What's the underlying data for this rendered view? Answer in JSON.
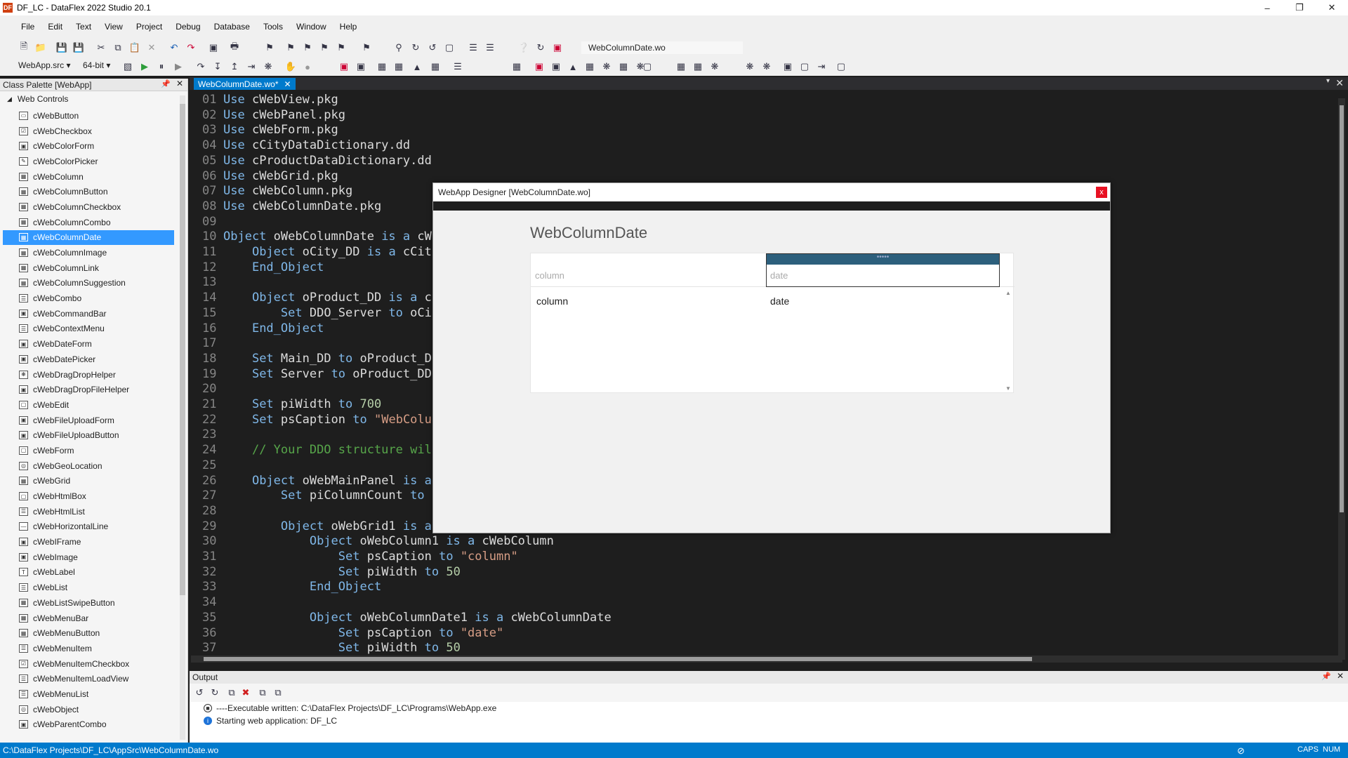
{
  "window": {
    "title": "DF_LC - DataFlex 2022 Studio 20.1",
    "logo": "DF"
  },
  "menu": [
    "File",
    "Edit",
    "Text",
    "View",
    "Project",
    "Debug",
    "Database",
    "Tools",
    "Window",
    "Help"
  ],
  "toolbar": {
    "current_file": "WebColumnDate.wo",
    "workspace": "WebApp.src",
    "bitness": "64-bit"
  },
  "class_palette": {
    "title": "Class Palette [WebApp]",
    "group": "Web Controls",
    "selected": "cWebColumnDate",
    "items": [
      "cWebButton",
      "cWebCheckbox",
      "cWebColorForm",
      "cWebColorPicker",
      "cWebColumn",
      "cWebColumnButton",
      "cWebColumnCheckbox",
      "cWebColumnCombo",
      "cWebColumnDate",
      "cWebColumnImage",
      "cWebColumnLink",
      "cWebColumnSuggestion",
      "cWebCombo",
      "cWebCommandBar",
      "cWebContextMenu",
      "cWebDateForm",
      "cWebDatePicker",
      "cWebDragDropHelper",
      "cWebDragDropFileHelper",
      "cWebEdit",
      "cWebFileUploadForm",
      "cWebFileUploadButton",
      "cWebForm",
      "cWebGeoLocation",
      "cWebGrid",
      "cWebHtmlBox",
      "cWebHtmlList",
      "cWebHorizontalLine",
      "cWebIFrame",
      "cWebImage",
      "cWebLabel",
      "cWebList",
      "cWebListSwipeButton",
      "cWebMenuBar",
      "cWebMenuButton",
      "cWebMenuItem",
      "cWebMenuItemCheckbox",
      "cWebMenuItemLoadView",
      "cWebMenuList",
      "cWebObject",
      "cWebParentCombo"
    ]
  },
  "editor": {
    "tab_label": "WebColumnDate.wo*",
    "lines": [
      [
        "01",
        [
          [
            "kw",
            "Use"
          ],
          [
            "t",
            " cWebView.pkg"
          ]
        ]
      ],
      [
        "02",
        [
          [
            "kw",
            "Use"
          ],
          [
            "t",
            " cWebPanel.pkg"
          ]
        ]
      ],
      [
        "03",
        [
          [
            "kw",
            "Use"
          ],
          [
            "t",
            " cWebForm.pkg"
          ]
        ]
      ],
      [
        "04",
        [
          [
            "kw",
            "Use"
          ],
          [
            "t",
            " cCityDataDictionary.dd"
          ]
        ]
      ],
      [
        "05",
        [
          [
            "kw",
            "Use"
          ],
          [
            "t",
            " cProductDataDictionary.dd"
          ]
        ]
      ],
      [
        "06",
        [
          [
            "kw",
            "Use"
          ],
          [
            "t",
            " cWebGrid.pkg"
          ]
        ]
      ],
      [
        "07",
        [
          [
            "kw",
            "Use"
          ],
          [
            "t",
            " cWebColumn.pkg"
          ]
        ]
      ],
      [
        "08",
        [
          [
            "kw",
            "Use"
          ],
          [
            "t",
            " cWebColumnDate.pkg"
          ]
        ]
      ],
      [
        "09",
        []
      ],
      [
        "10",
        [
          [
            "kw",
            "Object"
          ],
          [
            "t",
            " oWebColumnDate "
          ],
          [
            "kw",
            "is a"
          ],
          [
            "t",
            " cW"
          ]
        ]
      ],
      [
        "11",
        [
          [
            "t",
            "    "
          ],
          [
            "kw",
            "Object"
          ],
          [
            "t",
            " oCity_DD "
          ],
          [
            "kw",
            "is a"
          ],
          [
            "t",
            " cCit"
          ]
        ]
      ],
      [
        "12",
        [
          [
            "t",
            "    "
          ],
          [
            "kw",
            "End_Object"
          ]
        ]
      ],
      [
        "13",
        []
      ],
      [
        "14",
        [
          [
            "t",
            "    "
          ],
          [
            "kw",
            "Object"
          ],
          [
            "t",
            " oProduct_DD "
          ],
          [
            "kw",
            "is a"
          ],
          [
            "t",
            " c"
          ]
        ]
      ],
      [
        "15",
        [
          [
            "t",
            "        "
          ],
          [
            "kw",
            "Set"
          ],
          [
            "t",
            " DDO_Server "
          ],
          [
            "kw",
            "to"
          ],
          [
            "t",
            " oCi"
          ]
        ]
      ],
      [
        "16",
        [
          [
            "t",
            "    "
          ],
          [
            "kw",
            "End_Object"
          ]
        ]
      ],
      [
        "17",
        []
      ],
      [
        "18",
        [
          [
            "t",
            "    "
          ],
          [
            "kw",
            "Set"
          ],
          [
            "t",
            " Main_DD "
          ],
          [
            "kw",
            "to"
          ],
          [
            "t",
            " oProduct_D"
          ]
        ]
      ],
      [
        "19",
        [
          [
            "t",
            "    "
          ],
          [
            "kw",
            "Set"
          ],
          [
            "t",
            " Server "
          ],
          [
            "kw",
            "to"
          ],
          [
            "t",
            " oProduct_DD"
          ]
        ]
      ],
      [
        "20",
        []
      ],
      [
        "21",
        [
          [
            "t",
            "    "
          ],
          [
            "kw",
            "Set"
          ],
          [
            "t",
            " piWidth "
          ],
          [
            "kw",
            "to"
          ],
          [
            "t",
            " "
          ],
          [
            "num",
            "700"
          ]
        ]
      ],
      [
        "22",
        [
          [
            "t",
            "    "
          ],
          [
            "kw",
            "Set"
          ],
          [
            "t",
            " psCaption "
          ],
          [
            "kw",
            "to"
          ],
          [
            "t",
            " "
          ],
          [
            "str",
            "\"WebColu"
          ]
        ]
      ],
      [
        "23",
        []
      ],
      [
        "24",
        [
          [
            "t",
            "    "
          ],
          [
            "cmt",
            "// Your DDO structure wil"
          ]
        ]
      ],
      [
        "25",
        []
      ],
      [
        "26",
        [
          [
            "t",
            "    "
          ],
          [
            "kw",
            "Object"
          ],
          [
            "t",
            " oWebMainPanel "
          ],
          [
            "kw",
            "is a"
          ]
        ]
      ],
      [
        "27",
        [
          [
            "t",
            "        "
          ],
          [
            "kw",
            "Set"
          ],
          [
            "t",
            " piColumnCount "
          ],
          [
            "kw",
            "to"
          ]
        ]
      ],
      [
        "28",
        []
      ],
      [
        "29",
        [
          [
            "t",
            "        "
          ],
          [
            "kw",
            "Object"
          ],
          [
            "t",
            " oWebGrid1 "
          ],
          [
            "kw",
            "is a"
          ]
        ]
      ],
      [
        "30",
        [
          [
            "t",
            "            "
          ],
          [
            "kw",
            "Object"
          ],
          [
            "t",
            " oWebColumn1 "
          ],
          [
            "kw",
            "is a"
          ],
          [
            "t",
            " cWebColumn"
          ]
        ]
      ],
      [
        "31",
        [
          [
            "t",
            "                "
          ],
          [
            "kw",
            "Set"
          ],
          [
            "t",
            " psCaption "
          ],
          [
            "kw",
            "to"
          ],
          [
            "t",
            " "
          ],
          [
            "str",
            "\"column\""
          ]
        ]
      ],
      [
        "32",
        [
          [
            "t",
            "                "
          ],
          [
            "kw",
            "Set"
          ],
          [
            "t",
            " piWidth "
          ],
          [
            "kw",
            "to"
          ],
          [
            "t",
            " "
          ],
          [
            "num",
            "50"
          ]
        ]
      ],
      [
        "33",
        [
          [
            "t",
            "            "
          ],
          [
            "kw",
            "End_Object"
          ]
        ]
      ],
      [
        "34",
        []
      ],
      [
        "35",
        [
          [
            "t",
            "            "
          ],
          [
            "kw",
            "Object"
          ],
          [
            "t",
            " oWebColumnDate1 "
          ],
          [
            "kw",
            "is a"
          ],
          [
            "t",
            " cWebColumnDate"
          ]
        ]
      ],
      [
        "36",
        [
          [
            "t",
            "                "
          ],
          [
            "kw",
            "Set"
          ],
          [
            "t",
            " psCaption "
          ],
          [
            "kw",
            "to"
          ],
          [
            "t",
            " "
          ],
          [
            "str",
            "\"date\""
          ]
        ]
      ],
      [
        "37",
        [
          [
            "t",
            "                "
          ],
          [
            "kw",
            "Set"
          ],
          [
            "t",
            " piWidth "
          ],
          [
            "kw",
            "to"
          ],
          [
            "t",
            " "
          ],
          [
            "num",
            "50"
          ]
        ]
      ]
    ]
  },
  "designer": {
    "title": "WebApp Designer [WebColumnDate.wo]",
    "close": "x",
    "app_title": "WebColumnDate",
    "grid_dots": "•••••",
    "columns": [
      {
        "header": "column",
        "value": "column"
      },
      {
        "header": "date",
        "value": "date"
      }
    ]
  },
  "output": {
    "title": "Output",
    "lines": [
      {
        "icon": "stop-icon",
        "text": "----Executable written: C:\\DataFlex Projects\\DF_LC\\Programs\\WebApp.exe"
      },
      {
        "icon": "info-icon",
        "text": "Starting web application: DF_LC"
      }
    ]
  },
  "status": {
    "path": "C:\\DataFlex Projects\\DF_LC\\AppSrc\\WebColumnDate.wo",
    "caps": "CAPS",
    "num": "NUM"
  }
}
